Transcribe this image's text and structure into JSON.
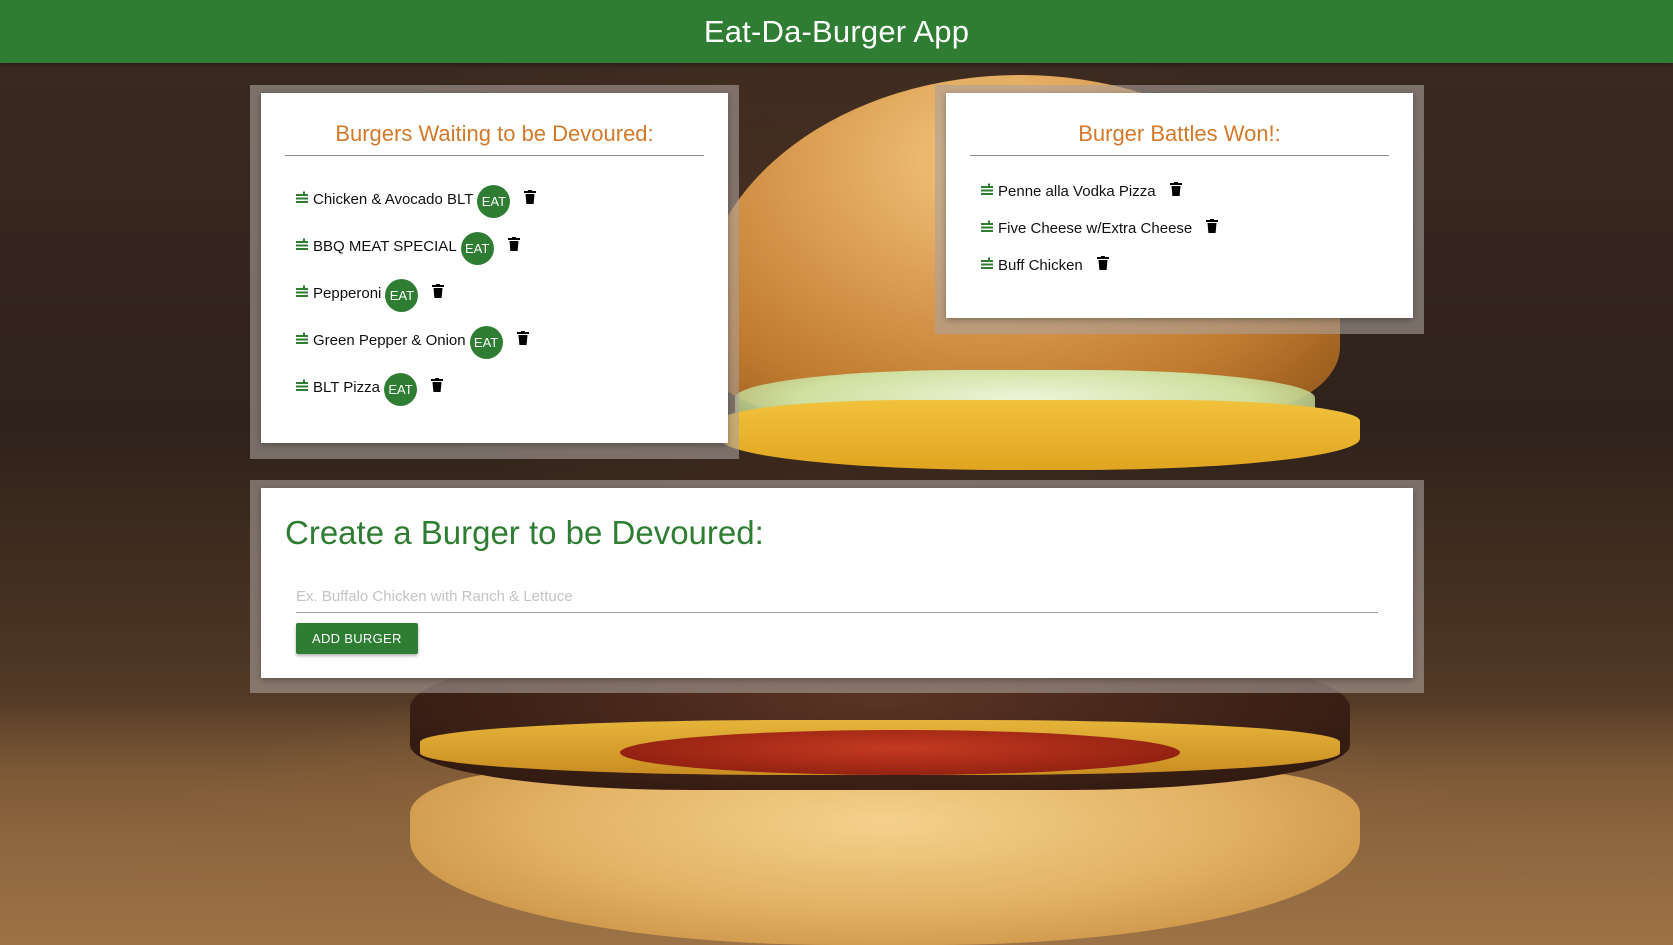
{
  "app": {
    "title": "Eat-Da-Burger App"
  },
  "waiting": {
    "title": "Burgers Waiting to be Devoured:",
    "eat_label": "EAT",
    "items": [
      {
        "name": "Chicken & Avocado BLT"
      },
      {
        "name": "BBQ MEAT SPECIAL"
      },
      {
        "name": "Pepperoni"
      },
      {
        "name": "Green Pepper & Onion"
      },
      {
        "name": "BLT Pizza"
      }
    ]
  },
  "won": {
    "title": "Burger Battles Won!:",
    "items": [
      {
        "name": "Penne alla Vodka Pizza"
      },
      {
        "name": "Five Cheese w/Extra Cheese"
      },
      {
        "name": "Buff Chicken"
      }
    ]
  },
  "create": {
    "title": "Create a Burger to be Devoured:",
    "input_value": "",
    "input_placeholder": "Ex. Buffalo Chicken with Ranch & Lettuce",
    "add_label": "ADD BURGER"
  },
  "icons": {
    "item_icon": "burger-stack-icon",
    "delete_icon": "trash-icon"
  },
  "colors": {
    "header_green": "#2e7d32",
    "card_title_orange": "#d4782a",
    "create_title_green": "#2e7d32"
  }
}
